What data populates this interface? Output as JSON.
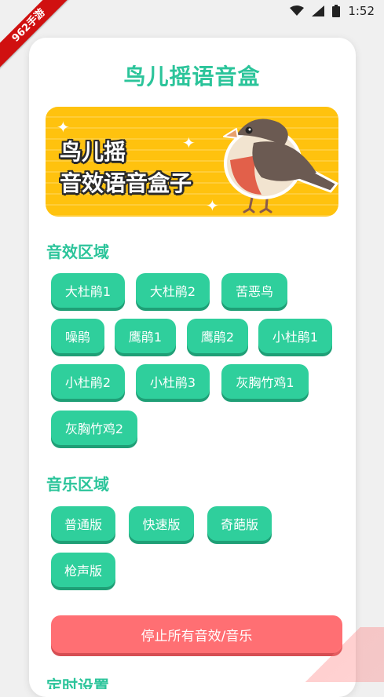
{
  "status_bar": {
    "time": "1:52"
  },
  "corner_ribbon": "962手游",
  "app": {
    "title": "鸟儿摇语音盒"
  },
  "banner": {
    "line1": "鸟儿摇",
    "line2": "音效语音盒子"
  },
  "sound_section": {
    "title": "音效区域",
    "buttons": [
      "大杜鹃1",
      "大杜鹃2",
      "苦恶鸟",
      "噪鹃",
      "鹰鹃1",
      "鹰鹃2",
      "小杜鹃1",
      "小杜鹃2",
      "小杜鹃3",
      "灰胸竹鸡1",
      "灰胸竹鸡2"
    ]
  },
  "music_section": {
    "title": "音乐区域",
    "buttons": [
      "普通版",
      "快速版",
      "奇葩版",
      "枪声版"
    ]
  },
  "stop_button": "停止所有音效/音乐",
  "next_section": {
    "title": "定时设置"
  },
  "colors": {
    "accent": "#2bc49a",
    "chip": "#2fcf9c",
    "stop": "#ff6f73",
    "banner": "#ffc20e"
  }
}
